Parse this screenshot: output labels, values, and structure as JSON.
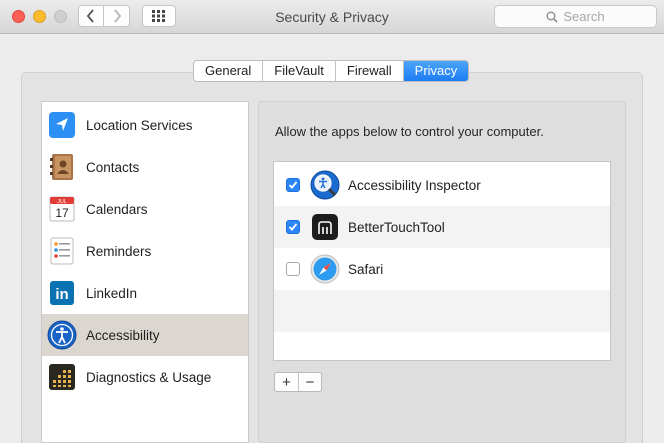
{
  "window": {
    "title": "Security & Privacy",
    "search_placeholder": "Search"
  },
  "tabs": [
    {
      "label": "General",
      "active": false
    },
    {
      "label": "FileVault",
      "active": false
    },
    {
      "label": "Firewall",
      "active": false
    },
    {
      "label": "Privacy",
      "active": true
    }
  ],
  "sidebar": {
    "items": [
      {
        "label": "Location Services",
        "icon": "location-arrow-icon"
      },
      {
        "label": "Contacts",
        "icon": "contacts-book-icon"
      },
      {
        "label": "Calendars",
        "icon": "calendar-icon",
        "icon_month": "JUL",
        "icon_day": "17"
      },
      {
        "label": "Reminders",
        "icon": "reminders-list-icon"
      },
      {
        "label": "LinkedIn",
        "icon": "linkedin-icon",
        "icon_text": "in"
      },
      {
        "label": "Accessibility",
        "icon": "accessibility-icon",
        "selected": true
      },
      {
        "label": "Diagnostics & Usage",
        "icon": "diagnostics-grid-icon"
      }
    ]
  },
  "main": {
    "description": "Allow the apps below to control your computer.",
    "apps": [
      {
        "name": "Accessibility Inspector",
        "checked": true,
        "icon": "accessibility-inspector-icon"
      },
      {
        "name": "BetterTouchTool",
        "checked": true,
        "icon": "bettertouchtool-icon"
      },
      {
        "name": "Safari",
        "checked": false,
        "icon": "safari-compass-icon"
      }
    ],
    "add_label": "+",
    "remove_label": "−"
  },
  "colors": {
    "accent": "#2c86f7",
    "selected_row": "#dcd6d1"
  }
}
